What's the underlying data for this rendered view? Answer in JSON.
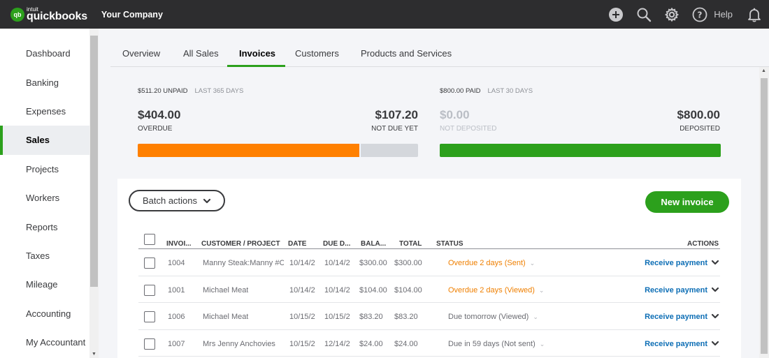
{
  "header": {
    "logo_badge": "qb",
    "logo_intuit": "intuit",
    "logo_text": "quickbooks",
    "company": "Your Company",
    "help_label": "Help",
    "icons": [
      "plus-circle-icon",
      "search-icon",
      "gear-icon",
      "help-icon",
      "bell-icon"
    ]
  },
  "sidebar": {
    "items": [
      {
        "label": "Dashboard"
      },
      {
        "label": "Banking"
      },
      {
        "label": "Expenses"
      },
      {
        "label": "Sales",
        "active": true
      },
      {
        "label": "Projects"
      },
      {
        "label": "Workers"
      },
      {
        "label": "Reports"
      },
      {
        "label": "Taxes"
      },
      {
        "label": "Mileage"
      },
      {
        "label": "Accounting"
      },
      {
        "label": "My Accountant"
      }
    ]
  },
  "tabs": [
    {
      "label": "Overview"
    },
    {
      "label": "All Sales"
    },
    {
      "label": "Invoices",
      "active": true
    },
    {
      "label": "Customers"
    },
    {
      "label": "Products and Services"
    }
  ],
  "summary": {
    "unpaid": {
      "title": "$511.20 UNPAID",
      "period": "LAST 365 DAYS",
      "overdue_amount": "$404.00",
      "overdue_label": "OVERDUE",
      "notdue_amount": "$107.20",
      "notdue_label": "NOT DUE YET",
      "overdue_fraction": 0.79
    },
    "paid": {
      "title": "$800.00 PAID",
      "period": "LAST 30 DAYS",
      "notdeposited_amount": "$0.00",
      "notdeposited_label": "NOT DEPOSITED",
      "deposited_amount": "$800.00",
      "deposited_label": "DEPOSITED",
      "deposited_fraction": 1.0
    }
  },
  "actions": {
    "batch_label": "Batch actions",
    "new_invoice_label": "New invoice"
  },
  "table": {
    "headers": {
      "invoice": "INVOI...",
      "customer": "CUSTOMER / PROJECT",
      "date": "DATE",
      "due": "DUE D...",
      "balance": "BALA...",
      "total": "TOTAL",
      "status": "STATUS",
      "actions": "ACTIONS"
    },
    "rows": [
      {
        "invoice": "1004",
        "customer": "Manny Steak:Manny #C",
        "date": "10/14/2",
        "due": "10/14/2",
        "balance": "$300.00",
        "total": "$300.00",
        "status": "Overdue 2 days (Sent)",
        "overdue": true,
        "action": "Receive payment"
      },
      {
        "invoice": "1001",
        "customer": "Michael Meat",
        "date": "10/14/2",
        "due": "10/14/2",
        "balance": "$104.00",
        "total": "$104.00",
        "status": "Overdue 2 days (Viewed)",
        "overdue": true,
        "action": "Receive payment"
      },
      {
        "invoice": "1006",
        "customer": "Michael Meat",
        "date": "10/15/2",
        "due": "10/15/2",
        "balance": "$83.20",
        "total": "$83.20",
        "status": "Due tomorrow (Viewed)",
        "overdue": false,
        "action": "Receive payment"
      },
      {
        "invoice": "1007",
        "customer": "Mrs Jenny Anchovies",
        "date": "10/15/2",
        "due": "12/14/2",
        "balance": "$24.00",
        "total": "$24.00",
        "status": "Due in 59 days (Not sent)",
        "overdue": false,
        "action": "Receive payment"
      }
    ]
  },
  "colors": {
    "brand": "#2ca01c",
    "overdue": "#ff8000",
    "notdue": "#d4d7dc",
    "deposited": "#2ca01c",
    "link": "#0d6eb5"
  }
}
